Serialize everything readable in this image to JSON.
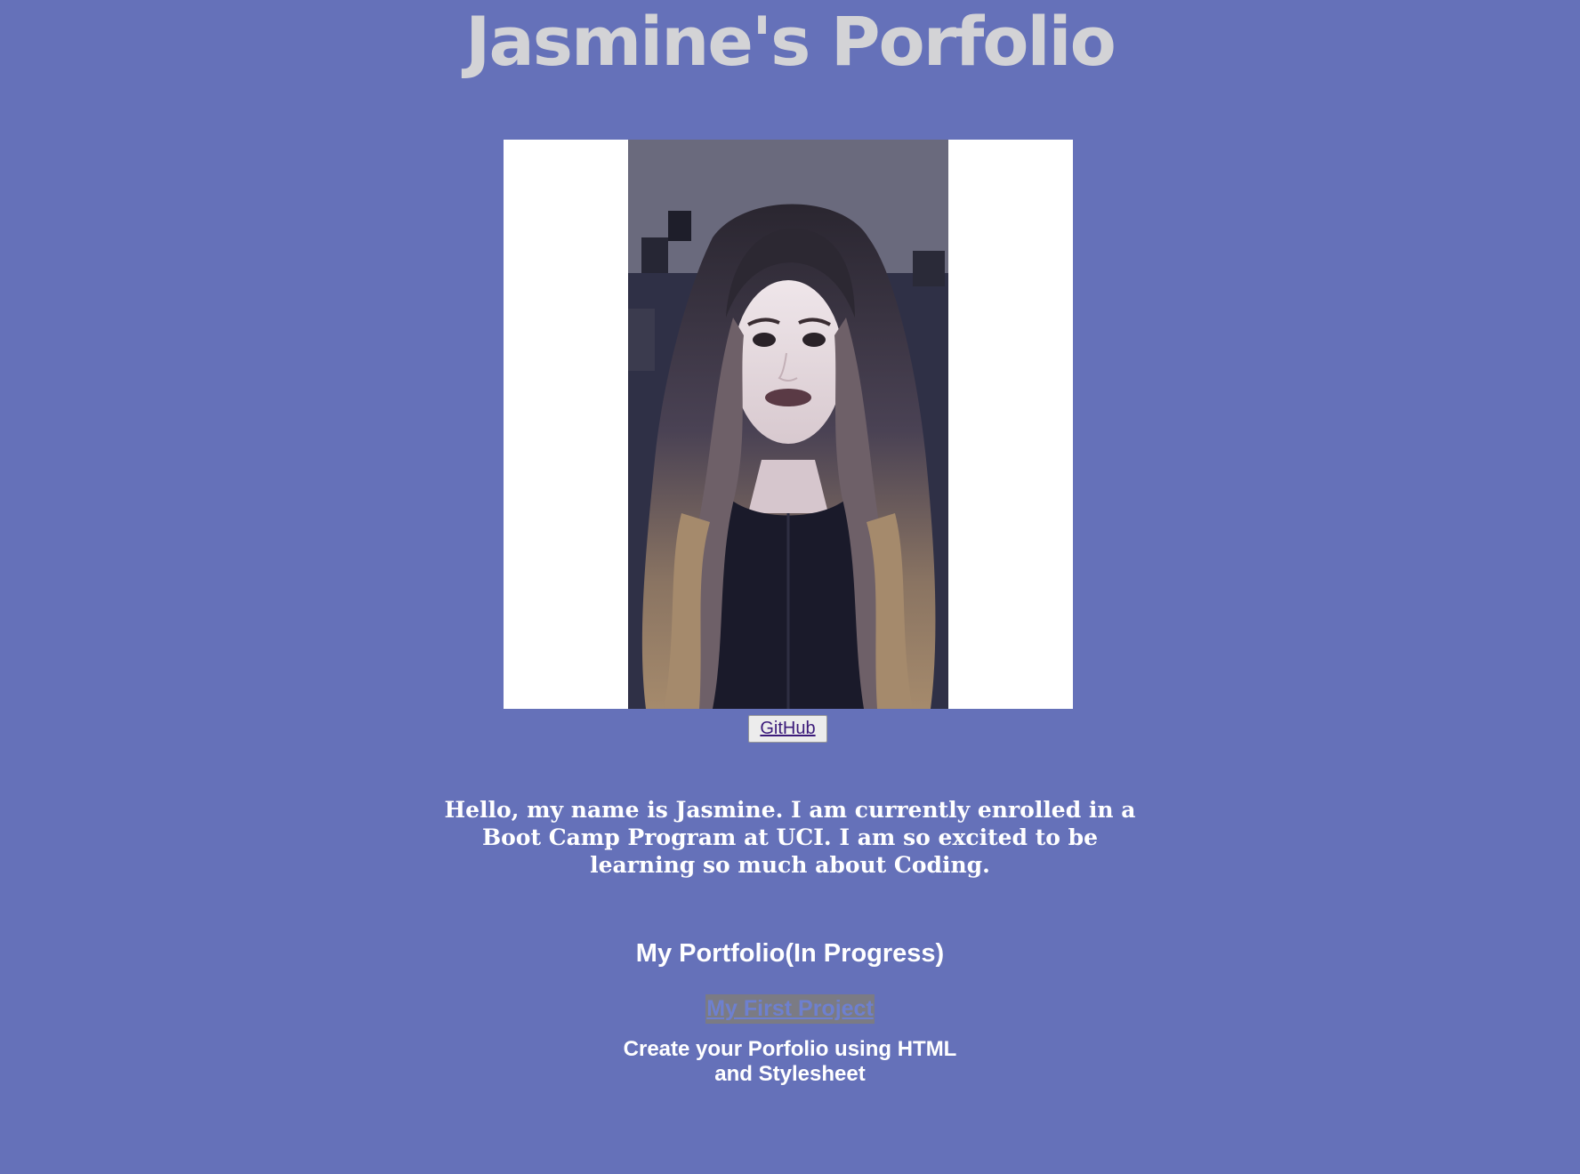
{
  "page": {
    "title": "Jasmine's Porfolio",
    "background_color": "#6571b9"
  },
  "profile": {
    "photo_icon": "portrait-photo",
    "github_label": "GitHub"
  },
  "about": {
    "intro": "Hello, my name is Jasmine. I am currently enrolled in a Boot Camp Program at UCI. I am so excited to be learning so much about Coding."
  },
  "portfolio": {
    "heading": "My Portfolio(In Progress)",
    "projects": [
      {
        "title": "My First Project",
        "description": "Create your Porfolio using HTML and Stylesheet"
      }
    ]
  }
}
